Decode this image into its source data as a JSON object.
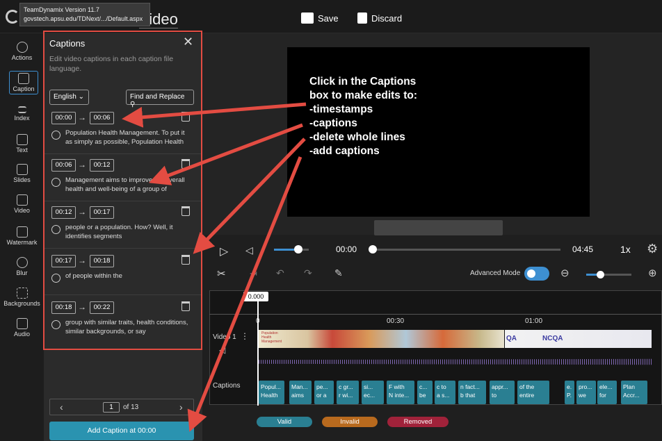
{
  "tooltip": {
    "line1": "TeamDynamix Version 11.7",
    "line2": "govstech.apsu.edu/TDNext/.../Default.aspx"
  },
  "app": {
    "title_suffix": "Video"
  },
  "topbar": {
    "save_label": "Save",
    "discard_label": "Discard"
  },
  "sidebar": {
    "items": [
      {
        "label": "Actions",
        "icon": "history-icon"
      },
      {
        "label": "Caption",
        "icon": "cc-icon"
      },
      {
        "label": "Index",
        "icon": "list-icon"
      },
      {
        "label": "Text",
        "icon": "text-icon"
      },
      {
        "label": "Slides",
        "icon": "slides-icon"
      },
      {
        "label": "Video",
        "icon": "video-icon"
      },
      {
        "label": "Watermark",
        "icon": "watermark-icon"
      },
      {
        "label": "Blur",
        "icon": "blur-icon"
      },
      {
        "label": "Backgrounds",
        "icon": "backgrounds-icon"
      },
      {
        "label": "Audio",
        "icon": "audio-icon"
      }
    ]
  },
  "panel": {
    "title": "Captions",
    "description": "Edit video captions in each caption file language.",
    "language": "English",
    "find_replace": "Find and Replace",
    "captions": [
      {
        "start": "00:00",
        "end": "00:06",
        "text": "Population Health Management. To put it as simply as possible, Population Health"
      },
      {
        "start": "00:06",
        "end": "00:12",
        "text": "Management aims to improve the overall health and well-being of a group of"
      },
      {
        "start": "00:12",
        "end": "00:17",
        "text": "people or a population. How? Well, it identifies segments"
      },
      {
        "start": "00:17",
        "end": "00:18",
        "text": "of people within the"
      },
      {
        "start": "00:18",
        "end": "00:22",
        "text": "group with similar traits, health conditions, similar backgrounds, or say"
      }
    ],
    "pager": {
      "current": "1",
      "total": "of 13"
    },
    "add_caption": "Add Caption at 00:00"
  },
  "instructions": [
    "Click in the Captions",
    "box to make edits to:",
    "-timestamps",
    "-captions",
    "-delete whole lines",
    "-add captions"
  ],
  "player": {
    "current_time": "00:00",
    "duration": "04:45",
    "speed": "1x",
    "progress": 0,
    "volume": 0.7
  },
  "tools": {
    "advanced_mode_label": "Advanced Mode",
    "advanced_mode_on": true,
    "zoom": 0.3
  },
  "timeline": {
    "playhead": "0.000",
    "ticks": [
      "0",
      "00:30",
      "01:00"
    ],
    "video_track_label": "Video 1",
    "captions_track_label": "Captions",
    "caption_blocks": [
      [
        "Popul...",
        "Health"
      ],
      [
        "Man...",
        "aims"
      ],
      [
        "pe...",
        "or a"
      ],
      [
        "c gr...",
        "r wi..."
      ],
      [
        "si...",
        "ec..."
      ],
      [
        "F with",
        "N inte..."
      ],
      [
        "c...",
        "be"
      ],
      [
        "c to",
        "a s..."
      ],
      [
        "n fact...",
        "b that"
      ],
      [
        "appr...",
        "to"
      ],
      [
        "of the",
        "entire"
      ],
      [
        "e.",
        "P."
      ],
      [
        "pro...",
        "we"
      ],
      [
        "ele...",
        "for"
      ],
      [
        "Plan",
        "Accr..."
      ]
    ]
  },
  "thumb_texts": {
    "t1": "Population Health Management",
    "t2": "QA",
    "t3": "NCQA"
  },
  "legend": {
    "valid": "Valid",
    "invalid": "Invalid",
    "removed": "Removed"
  },
  "colors": {
    "accent": "#2a93b0",
    "highlight": "#e34c42",
    "valid": "#2a7f92",
    "invalid": "#b86a1e",
    "removed": "#a0223a"
  }
}
